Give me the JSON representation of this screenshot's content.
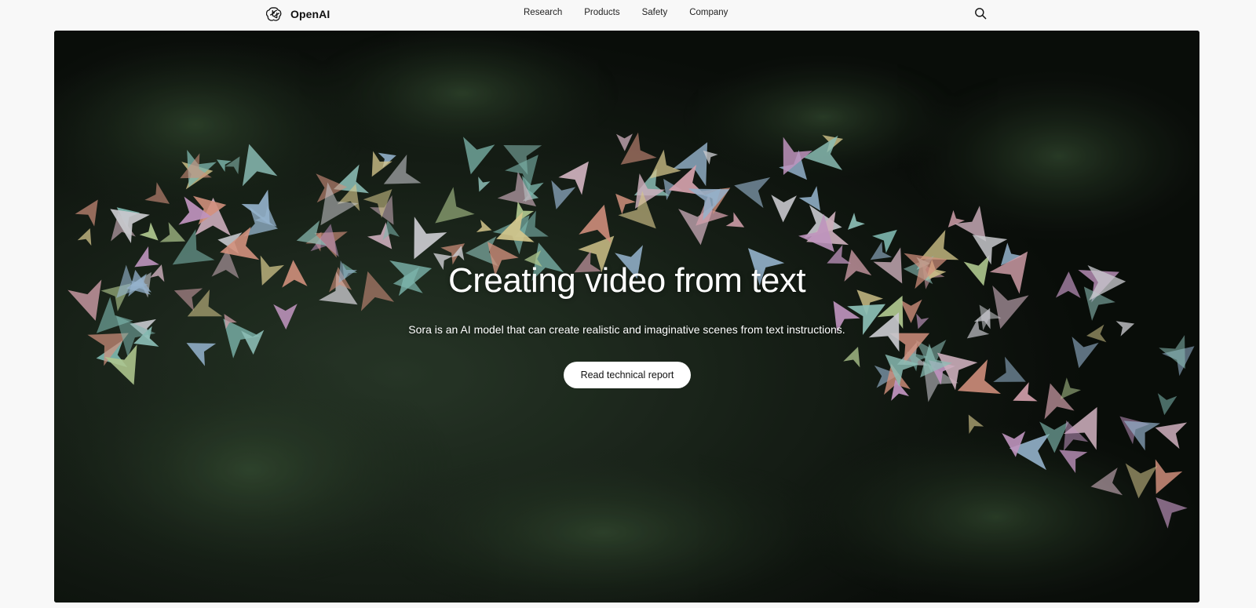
{
  "brand": {
    "name": "OpenAI",
    "logo_icon": "openai-knot-icon"
  },
  "nav": {
    "items": [
      {
        "label": "Research"
      },
      {
        "label": "Products"
      },
      {
        "label": "Safety"
      },
      {
        "label": "Company"
      }
    ],
    "search_icon": "search-icon"
  },
  "hero": {
    "title": "Creating video from text",
    "subtitle": "Sora is an AI model that can create realistic and imaginative scenes from text instructions.",
    "cta_label": "Read technical report",
    "media_description_icon": "paper-airplanes-over-foliage-image"
  },
  "colors": {
    "page_bg": "#f8f8f8",
    "text": "#111111",
    "hero_text": "#ffffff",
    "cta_bg": "#ffffff"
  }
}
